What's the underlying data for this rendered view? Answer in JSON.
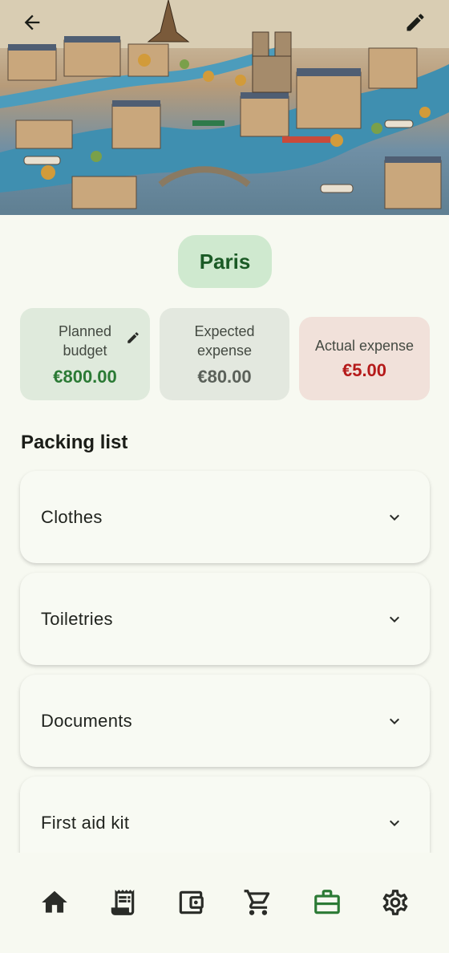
{
  "header": {
    "image_alt": "",
    "back_icon": "arrow-left-icon",
    "edit_icon": "pencil-icon"
  },
  "trip": {
    "city": "Paris"
  },
  "budget": {
    "planned_label": "Planned budget",
    "planned_value": "€800.00",
    "expected_label": "Expected expense",
    "expected_value": "€80.00",
    "actual_label": "Actual expense",
    "actual_value": "€5.00"
  },
  "packing": {
    "title": "Packing list",
    "items": [
      {
        "label": "Clothes"
      },
      {
        "label": "Toiletries"
      },
      {
        "label": "Documents"
      },
      {
        "label": "First aid kit"
      }
    ]
  },
  "nav": {
    "items": [
      {
        "name": "home",
        "icon": "home-icon",
        "active": false
      },
      {
        "name": "receipt",
        "icon": "receipt-icon",
        "active": false
      },
      {
        "name": "wallet",
        "icon": "wallet-icon",
        "active": false
      },
      {
        "name": "cart",
        "icon": "cart-icon",
        "active": false
      },
      {
        "name": "trips",
        "icon": "briefcase-icon",
        "active": true
      },
      {
        "name": "settings",
        "icon": "gear-icon",
        "active": false
      }
    ]
  },
  "colors": {
    "accent": "#2b7a35",
    "chip_bg": "#cfe9cf",
    "actual_red": "#b51a1a",
    "background": "#f7f9f1"
  }
}
